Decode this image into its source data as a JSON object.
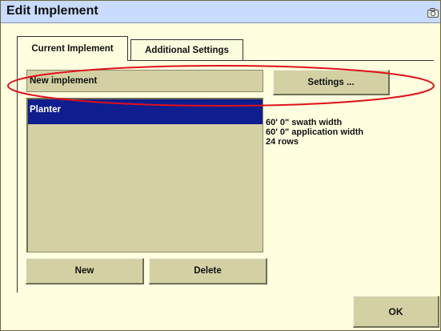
{
  "window": {
    "title": "Edit Implement",
    "icon": "camera-icon"
  },
  "tabs": [
    {
      "label": "Current Implement",
      "active": true
    },
    {
      "label": "Additional Settings",
      "active": false
    }
  ],
  "implement_select": {
    "value": "New implement"
  },
  "buttons": {
    "settings": "Settings ...",
    "new": "New",
    "delete": "Delete",
    "ok": "OK"
  },
  "implement_list": {
    "items": [
      {
        "label": "Planter",
        "selected": true
      }
    ]
  },
  "details": {
    "swath_width": "60' 0\" swath width",
    "application_width": "60' 0\" application width",
    "rows": "24 rows"
  },
  "colors": {
    "background": "#ffffe0",
    "control": "#d3d1a4",
    "selection": "#0e1e8e",
    "titlebar": "#c9dbff",
    "highlight_ellipse": "#e0101a"
  }
}
